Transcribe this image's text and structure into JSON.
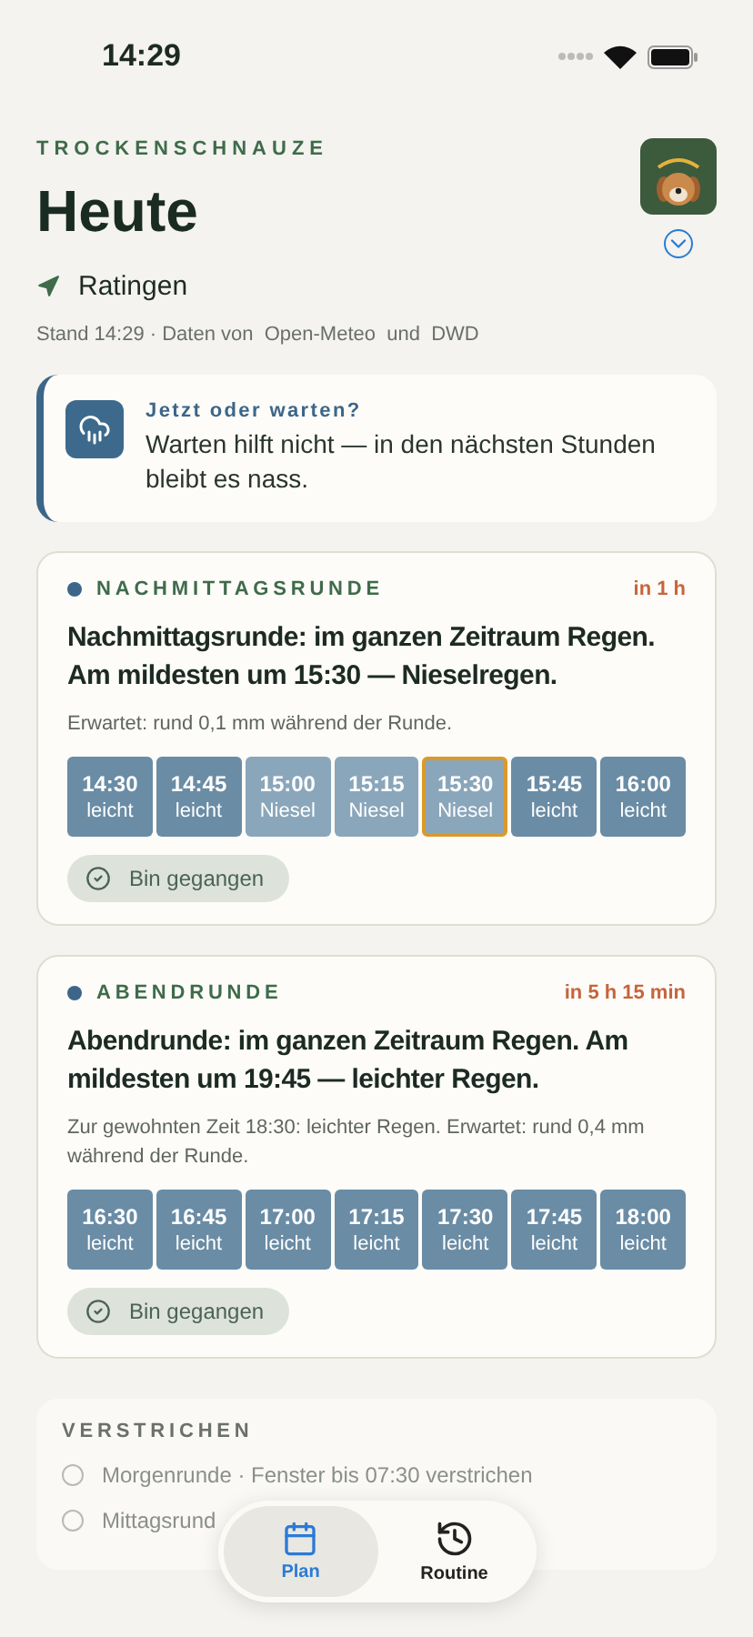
{
  "status_bar": {
    "time": "14:29"
  },
  "header": {
    "brand": "TROCKENSCHNAUZE",
    "title": "Heute",
    "location": "Ratingen",
    "source": "Stand 14:29 · Daten von  Open-Meteo  und  DWD"
  },
  "advice": {
    "title": "Jetzt oder warten?",
    "text": "Warten hilft nicht — in den nächsten Stunden bleibt es nass."
  },
  "walks": [
    {
      "name": "NACHMITTAGSRUNDE",
      "eta": "in 1 h",
      "summary": "Nachmittagsrunde: im ganzen Zeitraum Regen. Am mildesten um 15:30 — Nieselregen.",
      "detail": "Erwartet: rund 0,1 mm während der Runde.",
      "button": "Bin gegangen",
      "slots": [
        {
          "time": "14:30",
          "label": "leicht",
          "kind": "light",
          "selected": false
        },
        {
          "time": "14:45",
          "label": "leicht",
          "kind": "light",
          "selected": false
        },
        {
          "time": "15:00",
          "label": "Niesel",
          "kind": "drizzle",
          "selected": false
        },
        {
          "time": "15:15",
          "label": "Niesel",
          "kind": "drizzle",
          "selected": false
        },
        {
          "time": "15:30",
          "label": "Niesel",
          "kind": "drizzle",
          "selected": true
        },
        {
          "time": "15:45",
          "label": "leicht",
          "kind": "light",
          "selected": false
        },
        {
          "time": "16:00",
          "label": "leicht",
          "kind": "light",
          "selected": false
        }
      ]
    },
    {
      "name": "ABENDRUNDE",
      "eta": "in 5 h 15 min",
      "summary": "Abendrunde: im ganzen Zeitraum Regen. Am mildesten um 19:45 — leichter Regen.",
      "detail": "Zur gewohnten Zeit 18:30: leichter Regen. Erwartet: rund 0,4 mm während der Runde.",
      "button": "Bin gegangen",
      "slots": [
        {
          "time": "16:30",
          "label": "leicht",
          "kind": "light",
          "selected": false
        },
        {
          "time": "16:45",
          "label": "leicht",
          "kind": "light",
          "selected": false
        },
        {
          "time": "17:00",
          "label": "leicht",
          "kind": "light",
          "selected": false
        },
        {
          "time": "17:15",
          "label": "leicht",
          "kind": "light",
          "selected": false
        },
        {
          "time": "17:30",
          "label": "leicht",
          "kind": "light",
          "selected": false
        },
        {
          "time": "17:45",
          "label": "leicht",
          "kind": "light",
          "selected": false
        },
        {
          "time": "18:00",
          "label": "leicht",
          "kind": "light",
          "selected": false
        }
      ]
    }
  ],
  "passed": {
    "title": "VERSTRICHEN",
    "items": [
      "Morgenrunde · Fenster bis 07:30 verstrichen",
      "Mittagsrund"
    ]
  },
  "tabs": [
    {
      "label": "Plan",
      "kind": "calendar",
      "selected": true
    },
    {
      "label": "Routine",
      "kind": "history",
      "selected": false
    }
  ]
}
